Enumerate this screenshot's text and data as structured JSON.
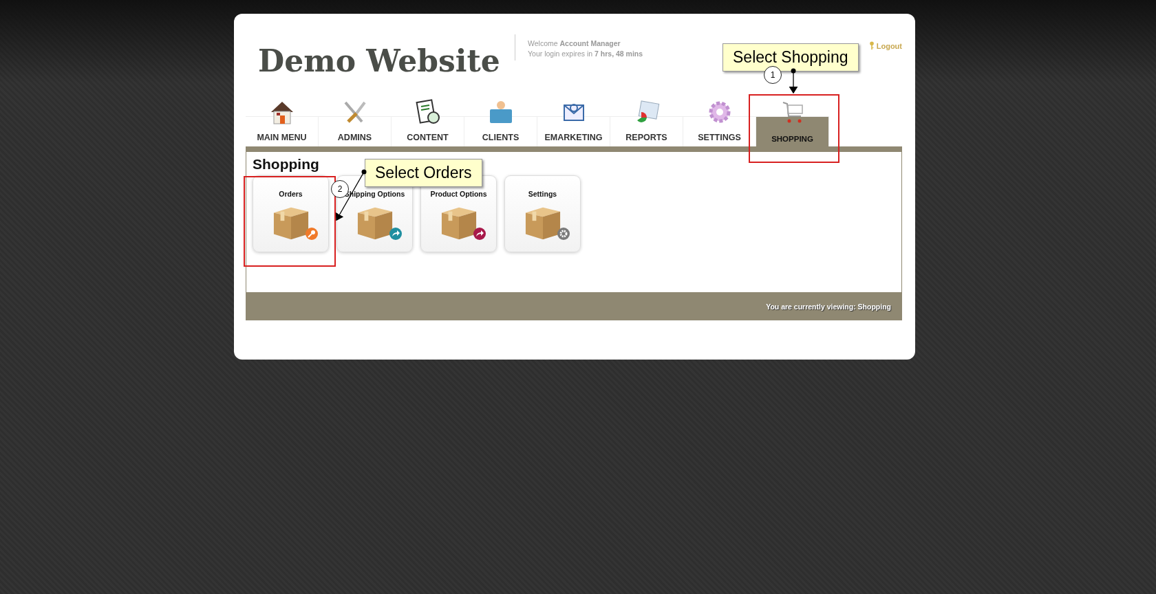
{
  "header": {
    "logo": "Demo Website",
    "welcome": "Welcome **Account Manager**",
    "expiry": "Your login expires in **7 hrs, 48 mins**",
    "logout": "Logout"
  },
  "nav": [
    {
      "label": "MAIN MENU",
      "kind": "house",
      "selected": false
    },
    {
      "label": "ADMINS",
      "kind": "tools",
      "selected": false
    },
    {
      "label": "CONTENT",
      "kind": "document",
      "selected": false
    },
    {
      "label": "CLIENTS",
      "kind": "folder",
      "selected": false
    },
    {
      "label": "EMARKETING",
      "kind": "mail",
      "selected": false
    },
    {
      "label": "REPORTS",
      "kind": "report",
      "selected": false
    },
    {
      "label": "SETTINGS",
      "kind": "gear",
      "selected": false
    },
    {
      "label": "SHOPPING",
      "kind": "cart",
      "selected": true
    }
  ],
  "section": {
    "title": "Shopping",
    "tiles": [
      {
        "label": "Orders",
        "kind": "key",
        "color": "#f07a2a"
      },
      {
        "label": "Shipping Options",
        "kind": "arrow",
        "color": "#1f8fa0"
      },
      {
        "label": "Product Options",
        "kind": "arrow",
        "color": "#a8194a"
      },
      {
        "label": "Settings",
        "kind": "gear",
        "color": "#7a7a7a"
      }
    ]
  },
  "status_bar": "You are currently viewing: Shopping",
  "annotations": [
    {
      "number": "1",
      "label": "Select Shopping"
    },
    {
      "number": "2",
      "label": "Select Orders"
    }
  ]
}
